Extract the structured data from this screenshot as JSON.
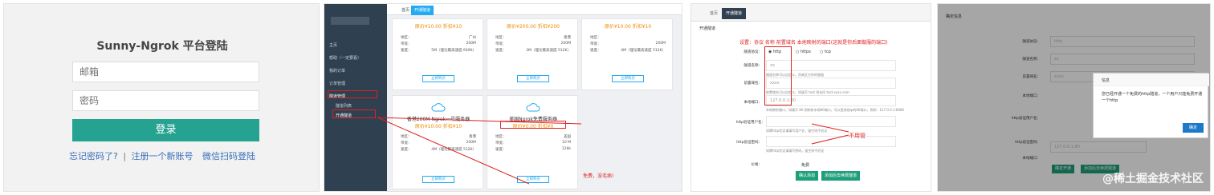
{
  "login": {
    "title": "Sunny-Ngrok 平台登陆",
    "email_placeholder": "邮箱",
    "password_placeholder": "密码",
    "submit_label": "登录",
    "forgot_link": "忘记密码了?",
    "separator": "|",
    "register_link": "注册一个新账号",
    "wechat_link": "微信扫码登陆"
  },
  "admin": {
    "tabs": [
      "首页",
      "开通隧道"
    ],
    "sidebar": [
      "主页",
      "帮助（一定要看）",
      "我的订单",
      "订单管理",
      "隧道管理",
      "隧道列表",
      "开通隧道"
    ],
    "cards_top": [
      {
        "price": "原价¥10.00  折扣¥10",
        "region": "广州",
        "bw": "200M",
        "speed": "5M（理论最高速度 640K）"
      },
      {
        "price": "原价¥200.00  折扣¥200",
        "region": "香港",
        "bw": "200M",
        "speed": "3M（理论最高速度 512K）"
      },
      {
        "price": "原价¥10.00  折扣¥10",
        "region": "",
        "bw": "200M",
        "speed": "4M（理论最高速度 512K）"
      }
    ],
    "kv_labels": [
      "地区：",
      "带宽：",
      "速度："
    ],
    "buy_label": "立即购买",
    "card_a": {
      "name": "香港200M Ngrok一号服务器",
      "price": "原价¥10.00  折扣¥10",
      "region": "香港",
      "bw": "200M",
      "speed": "4M（理论最高速度 512K）"
    },
    "card_b": {
      "name": "美国Ngrok免费服务器",
      "price": "原价¥0.00  折扣¥0",
      "region": "美国",
      "bw": "10 M",
      "speed": "128k"
    },
    "free_note": "免费，没毛病!"
  },
  "form": {
    "tabs": [
      "首页",
      "开通隧道"
    ],
    "section_title": "开通隧道",
    "labels": [
      "隧道协议：",
      "隧道名称：",
      "前置域名：",
      "本地端口：",
      "http验证用户名：",
      "http验证密码：",
      "价格："
    ],
    "protocols": [
      "http",
      "https",
      "tcp"
    ],
    "name_value": "xx",
    "domain_value": "xxxx",
    "port_value": "127.0.0.1:80",
    "price_value": "免费",
    "hint_name": "隧道名称可以自定义，用来区分你的隧道",
    "hint_domain": "前置域名可以自定义，如填写 test 则访问 test.xxxx.com",
    "hint_port": "本地映射端口，如填写 80 则映射本地80端口，可以是其他ip的80端口，例如：127.0.0.1:8080",
    "hint_user": "如需http验证请填写用户名，留空则不验证",
    "hint_pass": "如需http验证请填写密码，留空则不验证",
    "confirm_label": "确认添加",
    "more_label": "添加后去续费隧道",
    "annot_top": "设置：协议  名称    前置域名   本地映射的端口(这就是你后面做服的端口)",
    "annot_noneed": "不用管"
  },
  "confirm": {
    "section_title": "确定信息",
    "labels": [
      "隧道协议：",
      "隧道名称：",
      "前置域名：",
      "本地端口：",
      "http验证用户名：",
      "http验证密码：",
      "本地端口："
    ],
    "values": [
      "http",
      "xx",
      "xxxx",
      "",
      "",
      "",
      "127.0.0.1:80"
    ],
    "modal_title": "信息",
    "modal_body": "您已经开通一个免费的http隧道，一个用户只能免费开通一个http",
    "modal_ok": "确定",
    "btn_confirm": "确定开通",
    "btn_more": "添加后去续费隧道",
    "watermark": "@稀土掘金技术社区"
  }
}
